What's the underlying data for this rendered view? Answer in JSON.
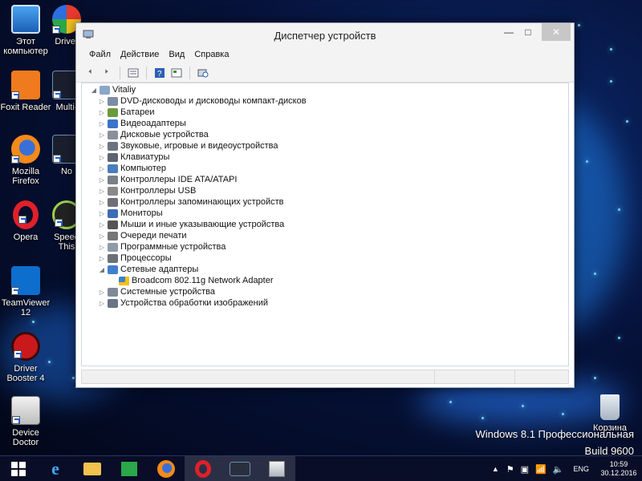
{
  "desktop": {
    "icons": [
      {
        "label": "Этот компьютер",
        "icon": "computer-icon"
      },
      {
        "label": "Driver",
        "icon": "driver-icon"
      },
      {
        "label": "Foxit Reader",
        "icon": "pdf-icon"
      },
      {
        "label": "Multi-",
        "icon": "nox-multi-icon"
      },
      {
        "label": "Mozilla Firefox",
        "icon": "firefox-icon"
      },
      {
        "label": "No",
        "icon": "nox-icon"
      },
      {
        "label": "Opera",
        "icon": "opera-icon"
      },
      {
        "label": "Speed This",
        "icon": "speedtest-icon"
      },
      {
        "label": "TeamViewer 12",
        "icon": "teamviewer-icon"
      },
      {
        "label": "Driver Booster 4",
        "icon": "driver-booster-icon"
      },
      {
        "label": "Device Doctor",
        "icon": "device-doctor-icon"
      },
      {
        "label": "Корзина",
        "icon": "recycle-bin-icon"
      }
    ],
    "watermark_line1": "Windows 8.1 Профессиональная",
    "watermark_line2": "Build 9600"
  },
  "window": {
    "title": "Диспетчер устройств",
    "menu": [
      "Файл",
      "Действие",
      "Вид",
      "Справка"
    ],
    "toolbar_icons": [
      "back-icon",
      "forward-icon",
      "properties-icon",
      "help-icon",
      "refresh-icon",
      "scan-hardware-icon"
    ],
    "tree": {
      "root": "Vitaliy",
      "items": [
        {
          "label": "DVD-дисководы и дисководы компакт-дисков",
          "expanded": false
        },
        {
          "label": "Батареи",
          "expanded": false
        },
        {
          "label": "Видеоадаптеры",
          "expanded": false
        },
        {
          "label": "Дисковые устройства",
          "expanded": false
        },
        {
          "label": "Звуковые, игровые и видеоустройства",
          "expanded": false
        },
        {
          "label": "Клавиатуры",
          "expanded": false
        },
        {
          "label": "Компьютер",
          "expanded": false
        },
        {
          "label": "Контроллеры IDE ATA/ATAPI",
          "expanded": false
        },
        {
          "label": "Контроллеры USB",
          "expanded": false
        },
        {
          "label": "Контроллеры запоминающих устройств",
          "expanded": false
        },
        {
          "label": "Мониторы",
          "expanded": false
        },
        {
          "label": "Мыши и иные указывающие устройства",
          "expanded": false
        },
        {
          "label": "Очереди печати",
          "expanded": false
        },
        {
          "label": "Программные устройства",
          "expanded": false
        },
        {
          "label": "Процессоры",
          "expanded": false
        },
        {
          "label": "Сетевые адаптеры",
          "expanded": true
        },
        {
          "label": "Broadcom 802.11g Network Adapter",
          "child": true,
          "warning": true
        },
        {
          "label": "Системные устройства",
          "expanded": false
        },
        {
          "label": "Устройства обработки изображений",
          "expanded": false
        }
      ]
    }
  },
  "taskbar": {
    "items": [
      "start-icon",
      "internet-explorer-icon",
      "file-explorer-icon",
      "store-icon",
      "firefox-icon",
      "opera-icon",
      "nox-icon",
      "device-manager-icon"
    ],
    "lang": "ENG",
    "time": "10:59",
    "date": "30.12.2016"
  }
}
